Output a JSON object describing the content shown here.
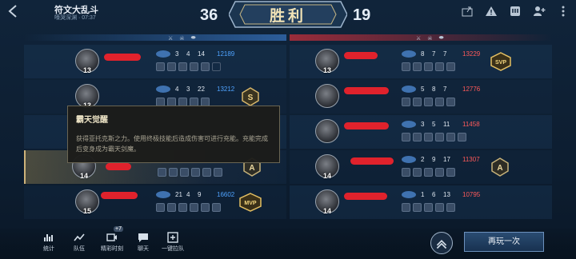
{
  "header": {
    "title": "符文大乱斗",
    "subtitle": "嚎哭深渊 · 07:37",
    "score_left": "36",
    "result": "胜利",
    "score_right": "19"
  },
  "col_headers": {
    "left": [
      "⚔",
      "☠",
      "⬬"
    ],
    "right": [
      "⚔",
      "☠",
      "⬬"
    ]
  },
  "left_team": [
    {
      "level": "13",
      "kills": "3",
      "deaths": "4",
      "assists": "14",
      "score": "12189",
      "badge": ""
    },
    {
      "level": "13",
      "kills": "4",
      "deaths": "3",
      "assists": "22",
      "score": "13212",
      "badge": "S"
    },
    {
      "level": "",
      "kills": "",
      "deaths": "",
      "assists": "",
      "score": "",
      "badge": ""
    },
    {
      "level": "14",
      "kills": "",
      "deaths": "",
      "assists": "",
      "score": "",
      "badge": "A"
    },
    {
      "level": "15",
      "kills": "21",
      "deaths": "4",
      "assists": "9",
      "score": "16602",
      "badge": "MVP"
    }
  ],
  "right_team": [
    {
      "level": "13",
      "kills": "8",
      "deaths": "7",
      "assists": "7",
      "score": "13229",
      "badge": "SVP"
    },
    {
      "level": "",
      "kills": "5",
      "deaths": "8",
      "assists": "7",
      "score": "12776",
      "badge": ""
    },
    {
      "level": "",
      "kills": "3",
      "deaths": "5",
      "assists": "11",
      "score": "11458",
      "badge": ""
    },
    {
      "level": "14",
      "kills": "2",
      "deaths": "9",
      "assists": "17",
      "score": "11307",
      "badge": "A"
    },
    {
      "level": "14",
      "kills": "1",
      "deaths": "6",
      "assists": "13",
      "score": "10795",
      "badge": ""
    }
  ],
  "tooltip": {
    "title": "霸天觉醒",
    "body": "获得亚托克斯之力。使用终极技能后造成伤害可进行充能。充能完成后变身成为霸天剑魔。"
  },
  "toolbar": {
    "stats": "统计",
    "team": "队伍",
    "highlights": "精彩时刻",
    "highlights_badge": "+7",
    "chat": "聊天",
    "invite": "一键拉队"
  },
  "play_again": "再玩一次",
  "colors": {
    "accent_blue": "#4fa3ff",
    "accent_red": "#ff5a5a",
    "redact": "#e0222c",
    "gold": "#cdb27a"
  }
}
